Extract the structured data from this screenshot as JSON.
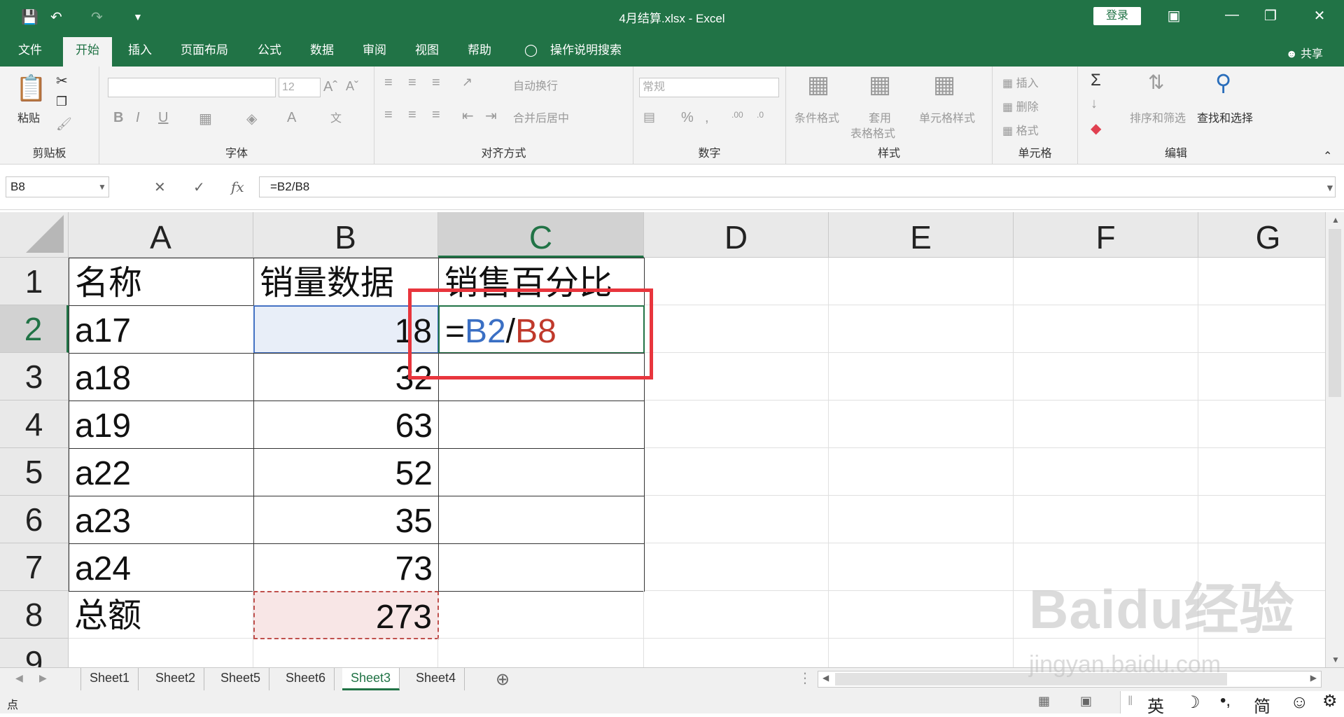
{
  "titlebar": {
    "filename": "4月结算.xlsx",
    "sep": " - ",
    "app": "Excel",
    "login": "登录"
  },
  "menu": {
    "tabs": [
      "文件",
      "开始",
      "插入",
      "页面布局",
      "公式",
      "数据",
      "审阅",
      "视图",
      "帮助"
    ],
    "tellme": "操作说明搜索",
    "share": "共享"
  },
  "ribbon": {
    "clipboard": {
      "label": "剪贴板",
      "paste": "粘贴"
    },
    "font": {
      "label": "字体",
      "size": "12"
    },
    "alignment": {
      "label": "对齐方式",
      "wrap": "自动换行",
      "merge": "合并后居中"
    },
    "number": {
      "label": "数字",
      "format": "常规"
    },
    "styles": {
      "label": "样式",
      "cond": "条件格式",
      "table1": "套用",
      "table2": "表格格式",
      "cell": "单元格样式"
    },
    "cells": {
      "label": "单元格",
      "insert": "插入",
      "delete": "删除",
      "format": "格式"
    },
    "editing": {
      "label": "编辑",
      "sort": "排序和筛选",
      "find": "查找和选择"
    }
  },
  "formula_bar": {
    "name_box": "B8",
    "formula": "=B2/B8"
  },
  "grid": {
    "columns": [
      "A",
      "B",
      "C",
      "D",
      "E",
      "F",
      "G"
    ],
    "rows": [
      "1",
      "2",
      "3",
      "4",
      "5",
      "6",
      "7",
      "8",
      "9"
    ],
    "A": [
      "名称",
      "a17",
      "a18",
      "a19",
      "a22",
      "a23",
      "a24",
      "总额"
    ],
    "B": [
      "销量数据",
      "18",
      "32",
      "63",
      "52",
      "35",
      "73",
      "273"
    ],
    "C1": "销售百分比",
    "C2": {
      "eq": "=",
      "ref1": "B2",
      "slash": "/",
      "ref2": "B8"
    }
  },
  "sheets": [
    "Sheet1",
    "Sheet2",
    "Sheet5",
    "Sheet6",
    "Sheet3",
    "Sheet4"
  ],
  "active_sheet": "Sheet3",
  "status": {
    "mode": "点",
    "ime": [
      "英",
      "简"
    ]
  },
  "watermark": {
    "brand": "Baidu经验",
    "url": "jingyan.baidu.com"
  }
}
